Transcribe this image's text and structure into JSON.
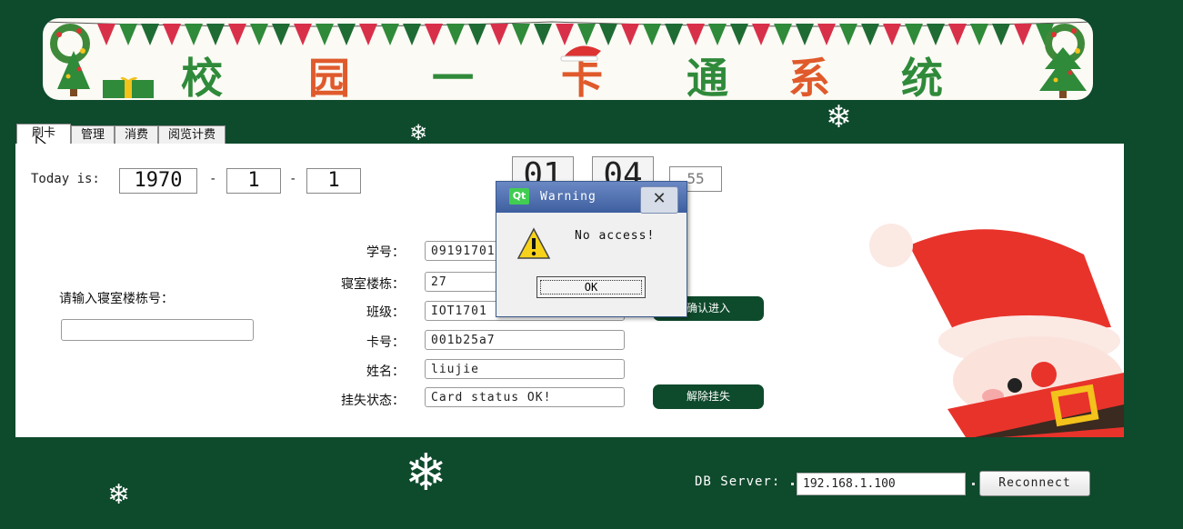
{
  "banner": {
    "title_chars": [
      "校",
      "园",
      "一",
      "卡",
      "通",
      "系",
      "统"
    ]
  },
  "tabs": [
    {
      "label": "刷卡",
      "active": true
    },
    {
      "label": "管理",
      "active": false
    },
    {
      "label": "消费",
      "active": false
    },
    {
      "label": "阅览计费",
      "active": false
    }
  ],
  "date": {
    "label": "Today is:",
    "year": "1970",
    "month": "1",
    "day": "1",
    "separator": "-"
  },
  "clock": {
    "hour": "01",
    "minute": "04",
    "second": "55"
  },
  "dorm_prompt": {
    "label": "请输入寝室楼栋号：",
    "value": ""
  },
  "fields": [
    {
      "label": "学号：",
      "value": "09191701"
    },
    {
      "label": "寝室楼栋：",
      "value": "27"
    },
    {
      "label": "班级：",
      "value": "IOT1701"
    },
    {
      "label": "卡号：",
      "value": "001b25a7"
    },
    {
      "label": "姓名：",
      "value": "liujie"
    },
    {
      "label": "挂失状态：",
      "value": "Card status OK!"
    }
  ],
  "buttons": {
    "confirm": "确认进入",
    "unlock": "解除挂失"
  },
  "dialog": {
    "app_icon": "Qt",
    "title": "Warning",
    "message": "No access!",
    "ok_label": "OK",
    "icon": "warning-icon"
  },
  "db": {
    "label": "DB Server:",
    "value": "192.168.1.100",
    "reconnect_label": "Reconnect"
  },
  "colors": {
    "background": "#0e4a2c",
    "button": "#0e4a2c",
    "santa_red": "#e8332b"
  }
}
